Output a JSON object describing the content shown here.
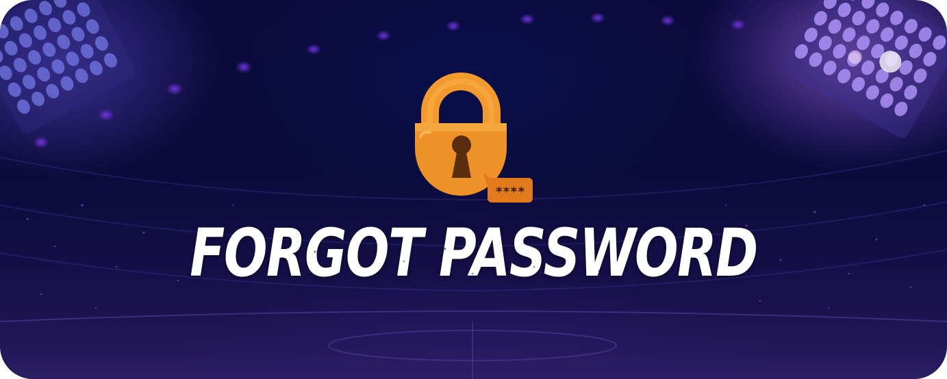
{
  "banner": {
    "title": "FORGOT PASSWORD",
    "lock_icon": "padlock-icon",
    "password_badge_text": "****"
  },
  "colors": {
    "background_dark": "#0a0b3a",
    "background_purple": "#3a2390",
    "lock_orange": "#f29a2e",
    "lock_body": "#ee9228",
    "badge_orange": "#e07a1c",
    "title_text": "#ffffff"
  }
}
